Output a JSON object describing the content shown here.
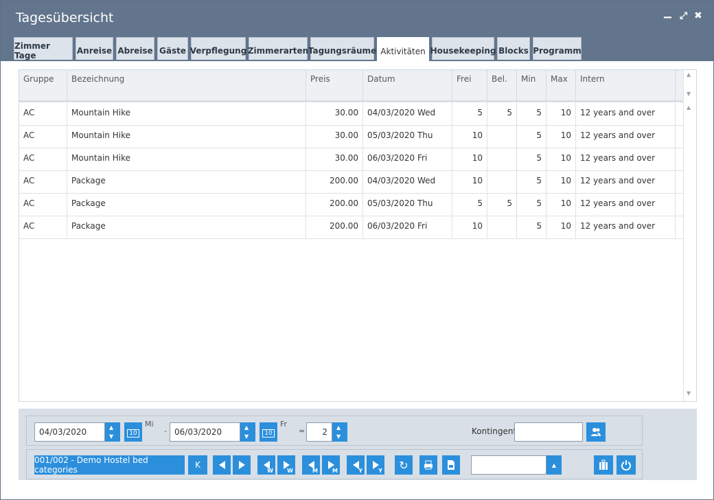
{
  "window": {
    "title": "Tagesübersicht",
    "minimize_icon": "minimize-icon",
    "maximize_icon": "maximize-icon",
    "close_icon": "close-icon"
  },
  "tabs": [
    {
      "label": "Zimmer Tage"
    },
    {
      "label": "Anreise"
    },
    {
      "label": "Abreise"
    },
    {
      "label": "Gäste"
    },
    {
      "label": "Verpflegung"
    },
    {
      "label": "Zimmerarten"
    },
    {
      "label": "Tagungsräume"
    },
    {
      "label": "Aktivitäten",
      "active": true
    },
    {
      "label": "Housekeeping"
    },
    {
      "label": "Blocks"
    },
    {
      "label": "Programm"
    }
  ],
  "grid": {
    "columns": [
      "Gruppe",
      "Bezeichnung",
      "Preis",
      "Datum",
      "Frei",
      "Bel.",
      "Min",
      "Max",
      "Intern"
    ],
    "rows": [
      [
        "AC",
        "Mountain Hike",
        "30.00",
        "04/03/2020 Wed",
        "5",
        "5",
        "5",
        "10",
        "12 years and over"
      ],
      [
        "AC",
        "Mountain Hike",
        "30.00",
        "05/03/2020 Thu",
        "10",
        "",
        "5",
        "10",
        "12 years and over"
      ],
      [
        "AC",
        "Mountain Hike",
        "30.00",
        "06/03/2020 Fri",
        "10",
        "",
        "5",
        "10",
        "12 years and over"
      ],
      [
        "AC",
        "Package",
        "200.00",
        "04/03/2020 Wed",
        "10",
        "",
        "5",
        "10",
        "12 years and over"
      ],
      [
        "AC",
        "Package",
        "200.00",
        "05/03/2020 Thu",
        "5",
        "5",
        "5",
        "10",
        "12 years and over"
      ],
      [
        "AC",
        "Package",
        "200.00",
        "06/03/2020 Fri",
        "10",
        "",
        "5",
        "10",
        "12 years and over"
      ]
    ]
  },
  "footer": {
    "date_from": "04/03/2020",
    "day_from": "Mi",
    "separator": "-",
    "date_to": "06/03/2020",
    "day_to": "Fr",
    "equals": "=",
    "days_count": "2",
    "kontingent_label": "Kontingent:",
    "kontingent_value": "",
    "category_button": "001/002 - Demo Hostel bed categories",
    "k_button": "K",
    "calendar_number": "10",
    "week_sub": "W",
    "month_sub": "M",
    "year_sub": "Y",
    "select_value": ""
  },
  "colors": {
    "titlebar": "#62758d",
    "accent": "#2b8fdc"
  }
}
